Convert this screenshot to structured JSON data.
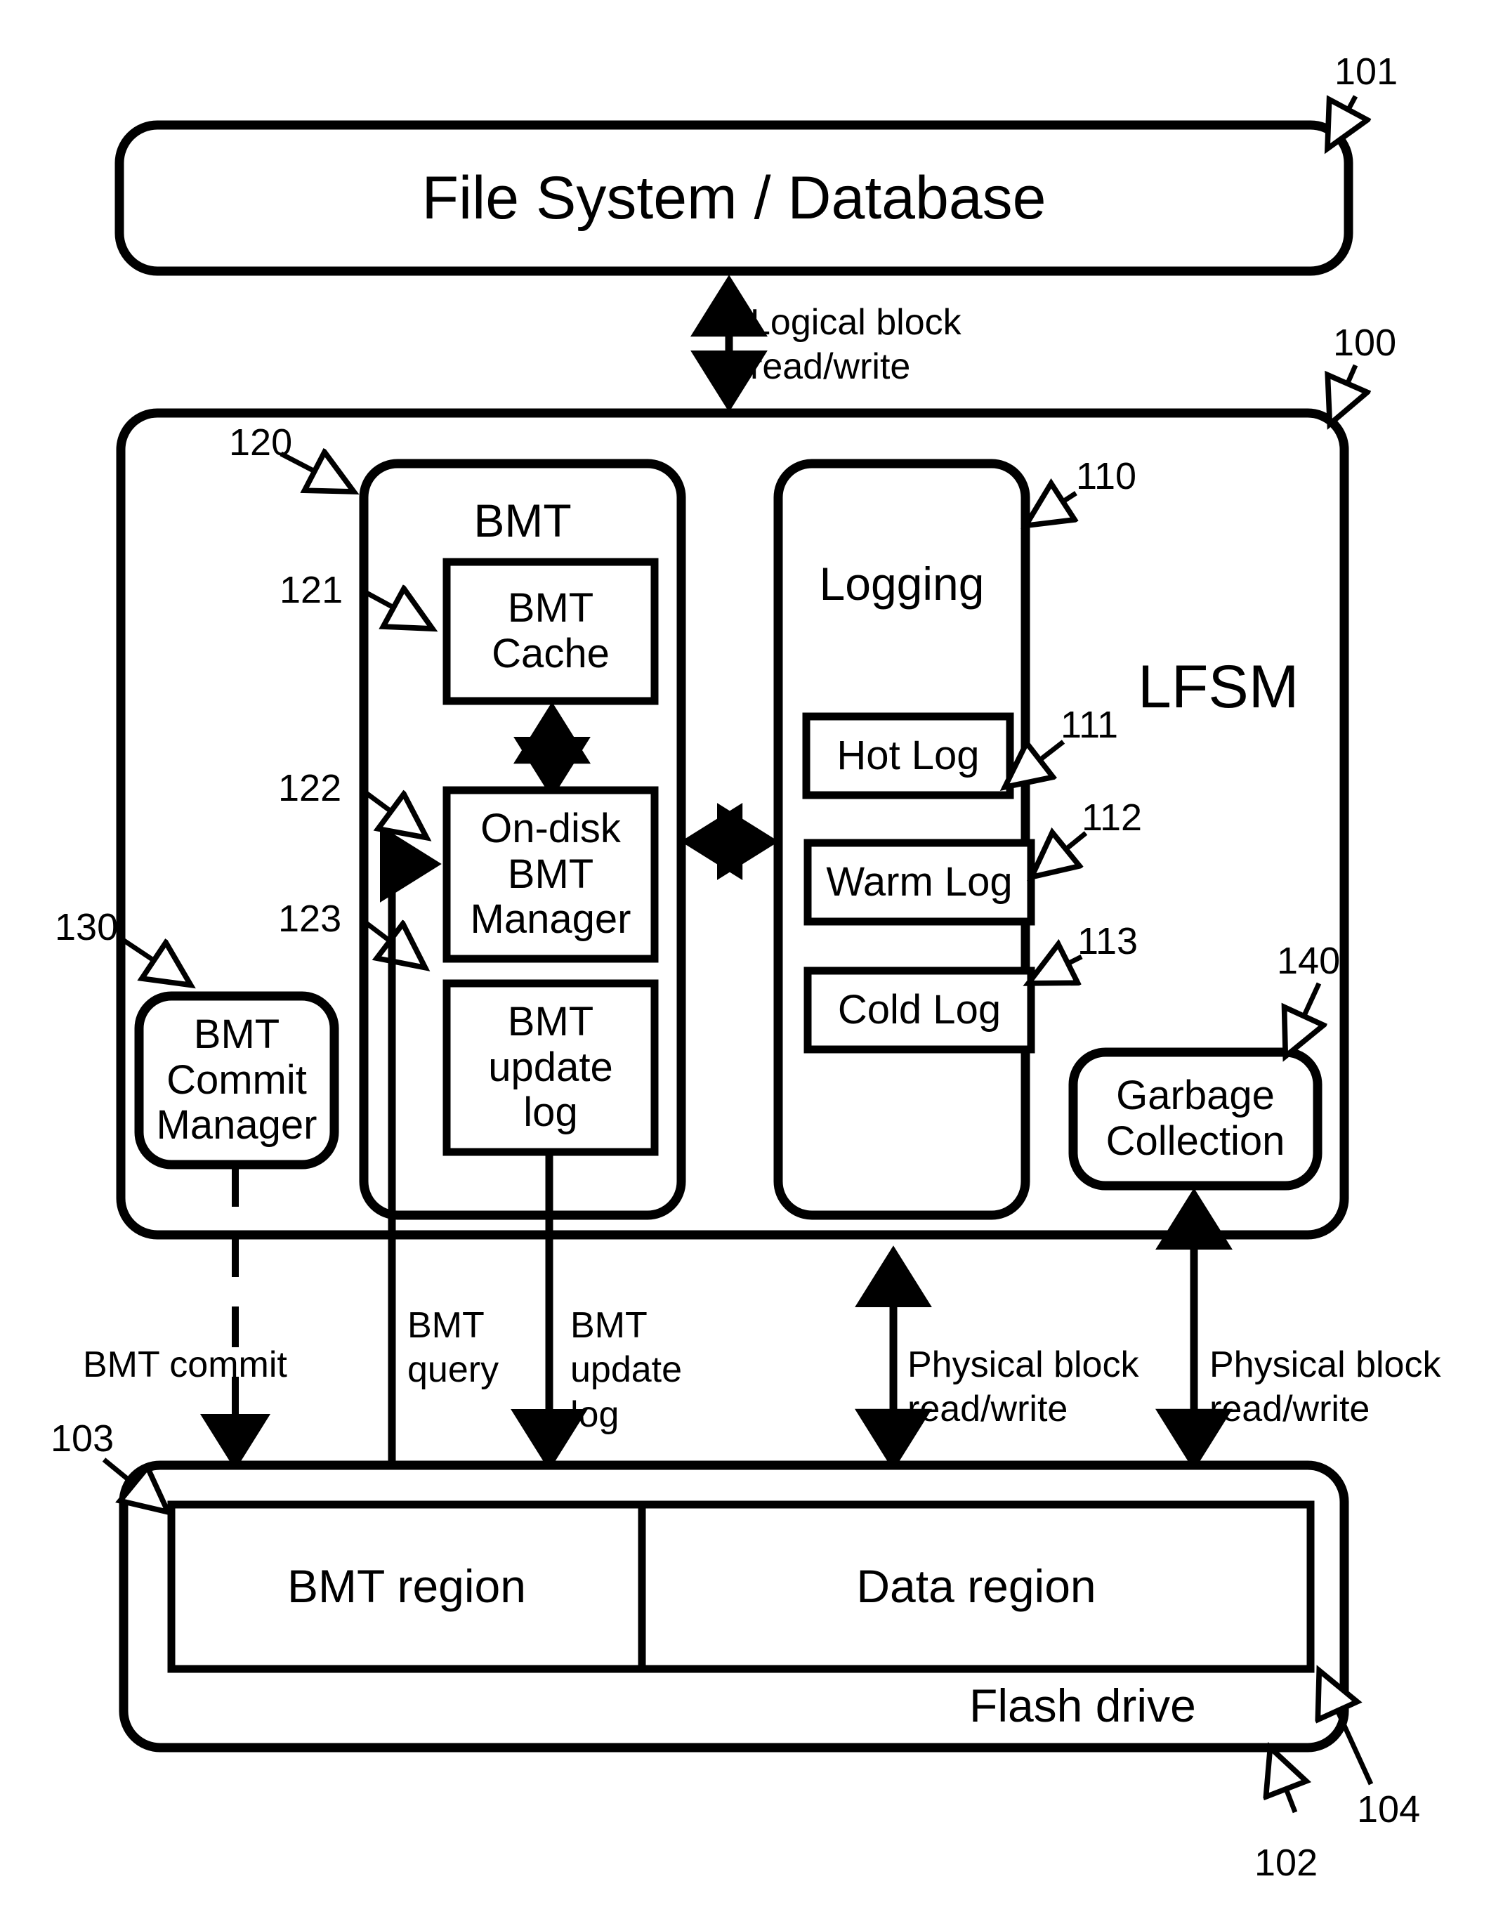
{
  "diagram": {
    "figure_type": "patent-block-diagram",
    "stroke_color": "#000000",
    "background_color": "#ffffff"
  },
  "blocks": {
    "file_system": {
      "label": "File System / Database",
      "ref": "101"
    },
    "lfsm": {
      "label": "LFSM",
      "ref": "100"
    },
    "bmt": {
      "label": "BMT",
      "ref": "120"
    },
    "bmt_cache": {
      "label": "BMT\nCache",
      "ref": "121"
    },
    "on_disk_bmt_manager": {
      "label": "On-disk\nBMT\nManager",
      "ref": "122"
    },
    "bmt_update_log": {
      "label": "BMT\nupdate\nlog",
      "ref": "123"
    },
    "logging": {
      "label": "Logging",
      "ref": "110"
    },
    "hot_log": {
      "label": "Hot Log",
      "ref": "111"
    },
    "warm_log": {
      "label": "Warm Log",
      "ref": "112"
    },
    "cold_log": {
      "label": "Cold Log",
      "ref": "113"
    },
    "bmt_commit_manager": {
      "label": "BMT\nCommit\nManager",
      "ref": "130"
    },
    "garbage_collection": {
      "label": "Garbage\nCollection",
      "ref": "140"
    },
    "flash_drive": {
      "label": "Flash drive",
      "ref": "102"
    },
    "bmt_region": {
      "label": "BMT region",
      "ref": "103"
    },
    "data_region": {
      "label": "Data region",
      "ref": "104"
    }
  },
  "connector_labels": {
    "logical_block": "Logical block\nread/write",
    "bmt_commit": "BMT commit",
    "bmt_query": "BMT\nquery",
    "bmt_update_log": "BMT\nupdate\nlog",
    "physical_block_left": "Physical block\nread/write",
    "physical_block_right": "Physical block\nread/write"
  },
  "reference_numerals": [
    {
      "id": "100",
      "value": "100",
      "points_to": "lfsm"
    },
    {
      "id": "101",
      "value": "101",
      "points_to": "file_system"
    },
    {
      "id": "102",
      "value": "102",
      "points_to": "flash_drive"
    },
    {
      "id": "103",
      "value": "103",
      "points_to": "bmt_region"
    },
    {
      "id": "104",
      "value": "104",
      "points_to": "data_region"
    },
    {
      "id": "110",
      "value": "110",
      "points_to": "logging"
    },
    {
      "id": "111",
      "value": "111",
      "points_to": "hot_log"
    },
    {
      "id": "112",
      "value": "112",
      "points_to": "warm_log"
    },
    {
      "id": "113",
      "value": "113",
      "points_to": "cold_log"
    },
    {
      "id": "120",
      "value": "120",
      "points_to": "bmt"
    },
    {
      "id": "121",
      "value": "121",
      "points_to": "bmt_cache"
    },
    {
      "id": "122",
      "value": "122",
      "points_to": "on_disk_bmt_manager"
    },
    {
      "id": "123",
      "value": "123",
      "points_to": "bmt_update_log"
    },
    {
      "id": "130",
      "value": "130",
      "points_to": "bmt_commit_manager"
    },
    {
      "id": "140",
      "value": "140",
      "points_to": "garbage_collection"
    }
  ]
}
